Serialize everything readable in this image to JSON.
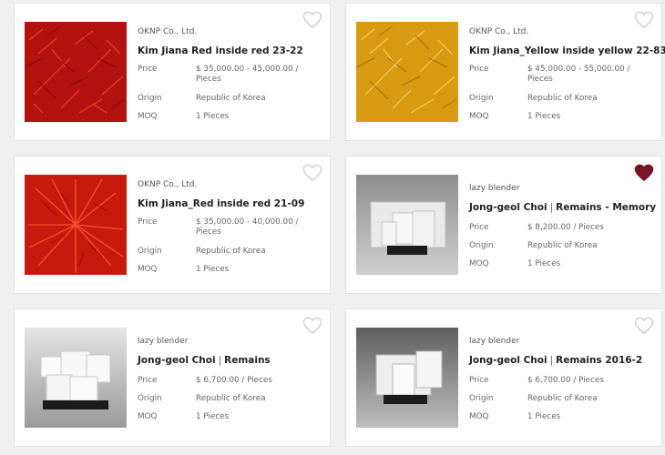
{
  "labels": {
    "price": "Price",
    "origin": "Origin",
    "moq": "MOQ"
  },
  "colors": {
    "heart_outline": "#cfcfcf",
    "heart_filled": "#7a1424"
  },
  "products": [
    {
      "seller": "OKNP Co., Ltd.",
      "title_a": "Kim Jiana Red inside red 23-22",
      "title_b": "",
      "price": "$ 35,000.00 - 45,000.00 / Pieces",
      "origin": "Republic of Korea",
      "moq": "1 Pieces",
      "favorited": false,
      "image": "red-painting"
    },
    {
      "seller": "OKNP Co., Ltd.",
      "title_a": "Kim Jiana_Yellow inside yellow 22-83",
      "title_b": "",
      "price": "$ 45,000.00 - 55,000.00 / Pieces",
      "origin": "Republic of Korea",
      "moq": "1 Pieces",
      "favorited": false,
      "image": "yellow-painting"
    },
    {
      "seller": "OKNP Co., Ltd.",
      "title_a": "Kim Jiana_Red inside red 21-09",
      "title_b": "",
      "price": "$ 35,000.00 - 40,000.00 / Pieces",
      "origin": "Republic of Korea",
      "moq": "1 Pieces",
      "favorited": false,
      "image": "red-painting"
    },
    {
      "seller": "lazy blender",
      "title_a": "Jong-geol Choi",
      "title_b": "Remains - Memory",
      "price": "$ 8,200.00 / Pieces",
      "origin": "Republic of Korea",
      "moq": "1 Pieces",
      "favorited": true,
      "image": "white-sculpture"
    },
    {
      "seller": "lazy blender",
      "title_a": "Jong-geol Choi",
      "title_b": "Remains",
      "price": "$ 6,700.00 / Pieces",
      "origin": "Republic of Korea",
      "moq": "1 Pieces",
      "favorited": false,
      "image": "white-sculpture"
    },
    {
      "seller": "lazy blender",
      "title_a": "Jong-geol Choi",
      "title_b": "Remains 2016-2",
      "price": "$ 6,700.00 / Pieces",
      "origin": "Republic of Korea",
      "moq": "1 Pieces",
      "favorited": false,
      "image": "white-sculpture"
    }
  ]
}
